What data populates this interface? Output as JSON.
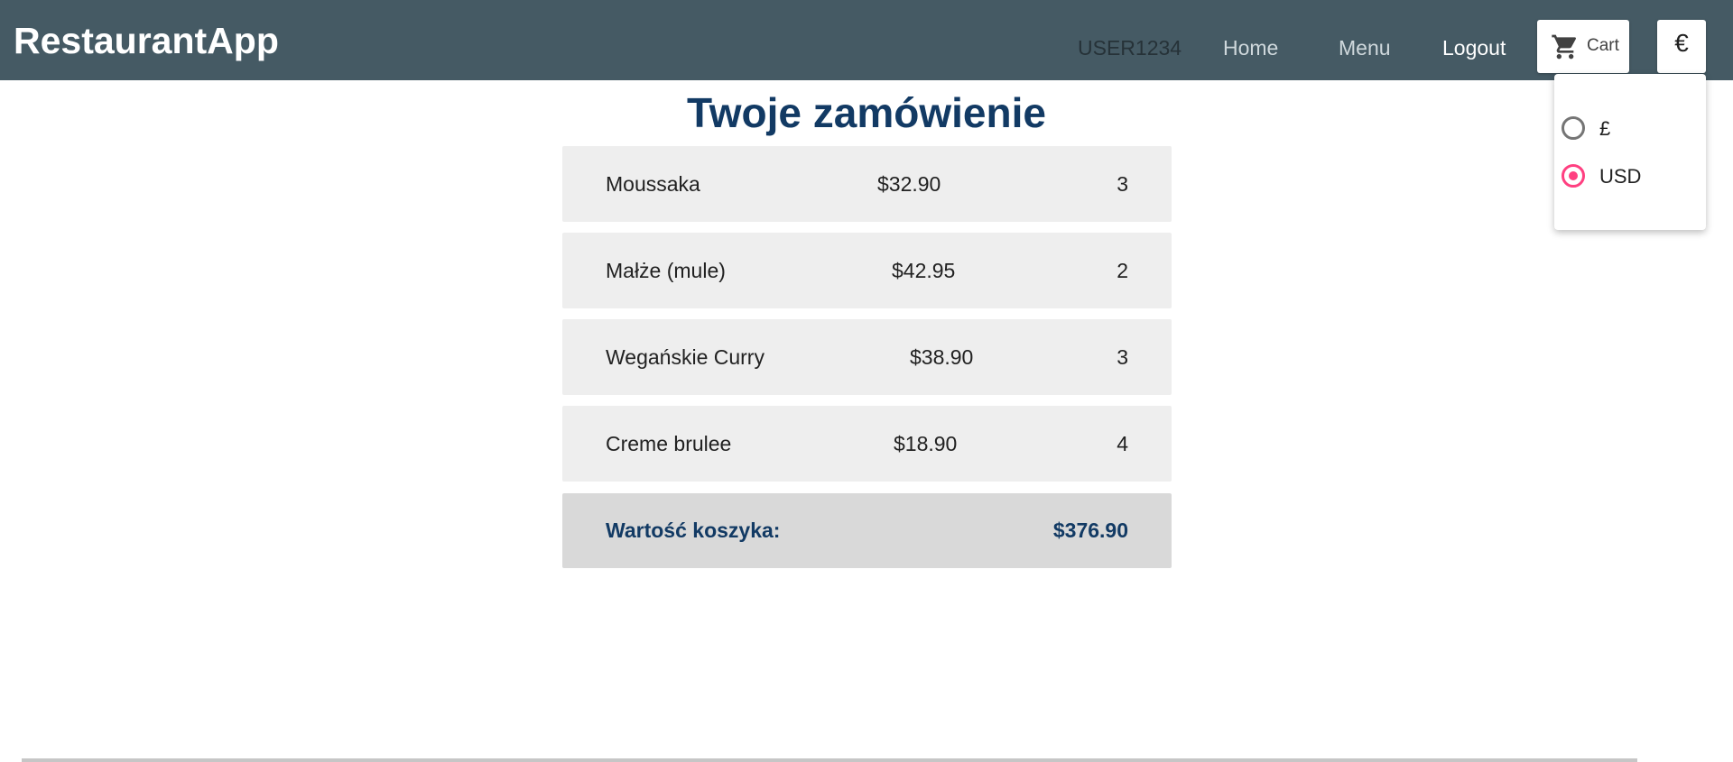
{
  "navbar": {
    "brand": "RestaurantApp",
    "user": "USER1234",
    "home": "Home",
    "menu": "Menu",
    "logout": "Logout",
    "cart_label": "Cart",
    "cart_icon": "cart-icon",
    "currency_symbol": "€"
  },
  "currency_dropdown": {
    "options": [
      {
        "label": "£",
        "checked": false
      },
      {
        "label": "USD",
        "checked": true
      }
    ]
  },
  "page": {
    "title": "Twoje zamówienie"
  },
  "order": {
    "items": [
      {
        "name": "Moussaka",
        "price": "$32.90",
        "qty": "3"
      },
      {
        "name": "Małże (mule)",
        "price": "$42.95",
        "qty": "2"
      },
      {
        "name": "Wegańskie Curry",
        "price": "$38.90",
        "qty": "3"
      },
      {
        "name": "Creme brulee",
        "price": "$18.90",
        "qty": "4"
      }
    ],
    "total_label": "Wartość koszyka:",
    "total_value": "$376.90"
  },
  "colors": {
    "navbar": "#455a64",
    "title": "#123a64",
    "radio_accent": "#ff4081",
    "row_bg": "#eeeeee",
    "total_bg": "#d9d9d9"
  }
}
